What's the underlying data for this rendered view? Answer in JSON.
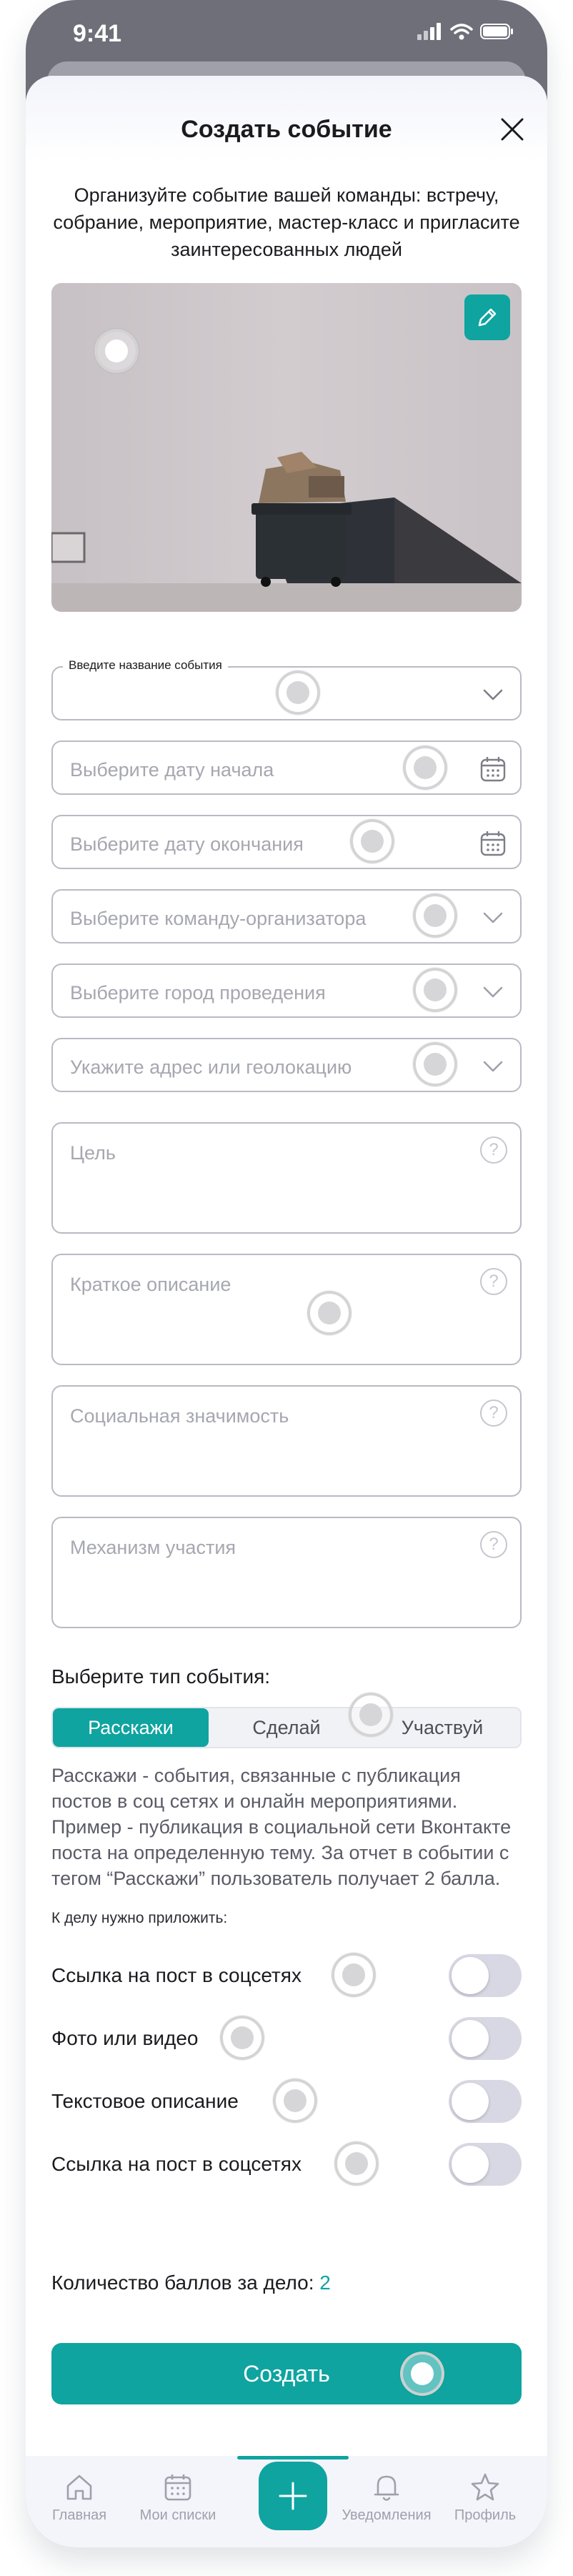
{
  "status_bar": {
    "time": "9:41"
  },
  "header": {
    "title": "Создать событие"
  },
  "intro_text": "Организуйте событие вашей команды: встречу, собрание, мероприятие, мастер-класс и пригласите заинтересованных людей",
  "fields": {
    "event_name_legend": "Введите название события",
    "start_date": "Выберите дату начала",
    "end_date": "Выберите дату окончания",
    "organizer_team": "Выберите команду-организатора",
    "city": "Выберите город проведения",
    "address": "Укажите адрес или геолокацию",
    "goal": "Цель",
    "short_description": "Краткое описание",
    "social_significance": "Социальная значимость",
    "participation_mechanism": "Механизм участия",
    "help_icon": "?"
  },
  "event_type": {
    "label": "Выберите тип события:",
    "options": [
      "Расскажи",
      "Сделай",
      "Участвуй"
    ],
    "selected": "Расскажи",
    "description": "Расскажи - события, связанные с публикация постов в соц сетях и онлайн мероприятиями. Пример - публикация в социальной сети Вконтакте поста на определенную тему. За отчет в событии с тегом “Расскажи” пользователь получает 2 балла."
  },
  "attachments": {
    "label": "К делу нужно приложить:",
    "items": [
      {
        "label": "Ссылка на пост в соцсетях",
        "on": false
      },
      {
        "label": "Фото или видео",
        "on": false
      },
      {
        "label": "Текстовое описание",
        "on": false
      },
      {
        "label": "Ссылка на пост в соцсетях",
        "on": false
      }
    ]
  },
  "points": {
    "label": "Количество баллов за дело:",
    "value": "2"
  },
  "create_button": "Создать",
  "tabbar": {
    "items": [
      {
        "label": "Главная",
        "icon": "home-icon"
      },
      {
        "label": "Мои списки",
        "icon": "calendar-icon"
      },
      {
        "label": "",
        "icon": "plus-icon"
      },
      {
        "label": "Уведомления",
        "icon": "bell-icon"
      },
      {
        "label": "Профиль",
        "icon": "star-icon"
      }
    ]
  },
  "colors": {
    "accent": "#0fa4a0",
    "field_border": "#b9bac3",
    "placeholder": "#a6a7b0",
    "frame": "#6e6f79"
  }
}
